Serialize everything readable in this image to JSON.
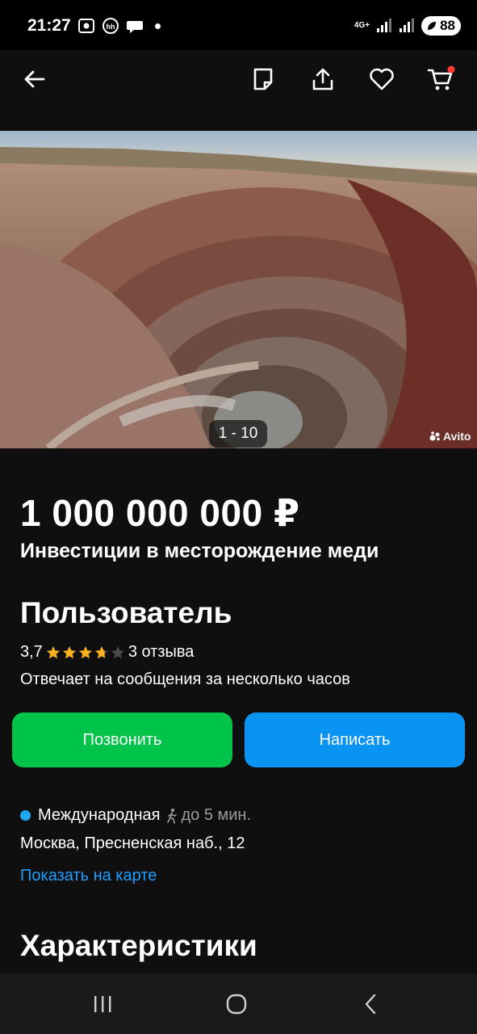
{
  "status": {
    "time": "21:27",
    "network": "4G+",
    "battery": "88"
  },
  "listing": {
    "gallery_counter": "1 - 10",
    "watermark": "Avito",
    "price": "1 000 000 000 ₽",
    "title": "Инвестиции в месторождение меди"
  },
  "seller": {
    "name": "Пользователь",
    "rating": "3,7",
    "rating_value": 3.7,
    "reviews": "3 отзыва",
    "response_time": "Отвечает на сообщения за несколько часов"
  },
  "actions": {
    "call": "Позвонить",
    "message": "Написать"
  },
  "location": {
    "metro": "Международная",
    "walk": "до 5 мин.",
    "address": "Москва, Пресненская наб., 12",
    "map_link": "Показать на карте"
  },
  "sections": {
    "specs": "Характеристики"
  },
  "colors": {
    "call": "#00c34a",
    "message": "#0994f3",
    "link": "#1c9dff",
    "star": "#ffb21e"
  }
}
